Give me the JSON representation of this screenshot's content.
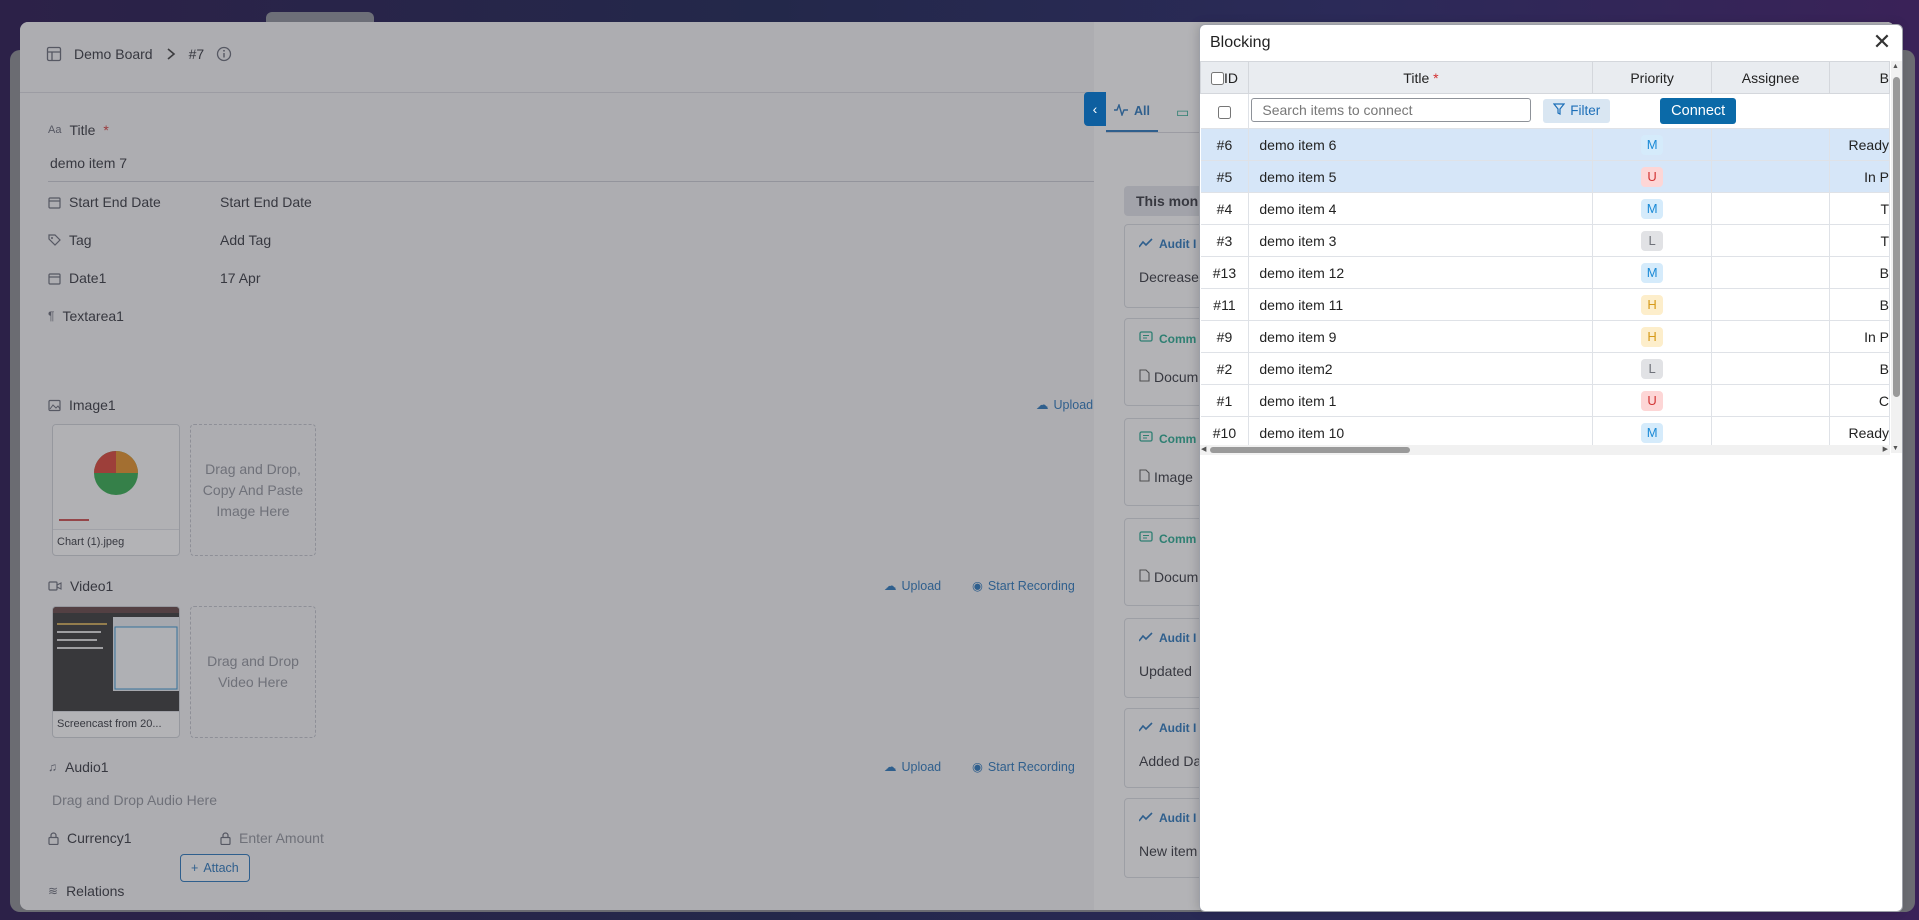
{
  "window": {
    "breadcrumb_board": "Demo Board",
    "breadcrumb_item": "#7"
  },
  "form": {
    "title_label": "Title",
    "title_value": "demo item 7",
    "start_end_label": "Start End Date",
    "start_end_value": "Start End Date",
    "tag_label": "Tag",
    "tag_value": "Add Tag",
    "date1_label": "Date1",
    "date1_value": "17 Apr",
    "textarea1_label": "Textarea1",
    "image1_label": "Image1",
    "image_upload": "Upload",
    "image_file": "Chart (1).jpeg",
    "image_drop": "Drag and Drop, Copy And Paste Image Here",
    "video1_label": "Video1",
    "video_upload": "Upload",
    "video_record": "Start Recording",
    "video_file": "Screencast from 20...",
    "video_drop": "Drag and Drop Video Here",
    "audio1_label": "Audio1",
    "audio_upload": "Upload",
    "audio_record": "Start Recording",
    "audio_drop": "Drag and Drop Audio Here",
    "currency1_label": "Currency1",
    "currency_placeholder": "Enter Amount",
    "relations_label": "Relations",
    "attach_label": "Attach"
  },
  "activity": {
    "tab_all": "All",
    "month_label": "This mon",
    "cards": [
      {
        "kind": "audit",
        "header": "Audit I",
        "body": "Decrease"
      },
      {
        "kind": "comment",
        "header": "Comm",
        "body": "Docum"
      },
      {
        "kind": "comment",
        "header": "Comm",
        "body": "Image"
      },
      {
        "kind": "comment",
        "header": "Comm",
        "body": "Docum"
      },
      {
        "kind": "audit",
        "header": "Audit I",
        "body": "Updated"
      },
      {
        "kind": "audit",
        "header": "Audit I",
        "body": "Added Da"
      },
      {
        "kind": "audit",
        "header": "Audit I",
        "body": "New item"
      }
    ]
  },
  "dialog": {
    "title": "Blocking",
    "columns": {
      "id": "ID",
      "title": "Title",
      "priority": "Priority",
      "assignee": "Assignee",
      "status": "B"
    },
    "search_placeholder": "Search items to connect",
    "filter_label": "Filter",
    "connect_label": "Connect",
    "rows": [
      {
        "id": "#6",
        "title": "demo item 6",
        "priority": "M",
        "status": "Ready",
        "selected": true
      },
      {
        "id": "#5",
        "title": "demo item 5",
        "priority": "U",
        "status": "In P",
        "selected": true
      },
      {
        "id": "#4",
        "title": "demo item 4",
        "priority": "M",
        "status": "T",
        "selected": false
      },
      {
        "id": "#3",
        "title": "demo item 3",
        "priority": "L",
        "status": "T",
        "selected": false
      },
      {
        "id": "#13",
        "title": "demo item 12",
        "priority": "M",
        "status": "B",
        "selected": false
      },
      {
        "id": "#11",
        "title": "demo item 11",
        "priority": "H",
        "status": "B",
        "selected": false
      },
      {
        "id": "#9",
        "title": "demo item 9",
        "priority": "H",
        "status": "In P",
        "selected": false
      },
      {
        "id": "#2",
        "title": "demo item2",
        "priority": "L",
        "status": "B",
        "selected": false
      },
      {
        "id": "#1",
        "title": "demo item 1",
        "priority": "U",
        "status": "C",
        "selected": false
      },
      {
        "id": "#10",
        "title": "demo item 10",
        "priority": "M",
        "status": "Ready",
        "selected": false
      }
    ]
  }
}
